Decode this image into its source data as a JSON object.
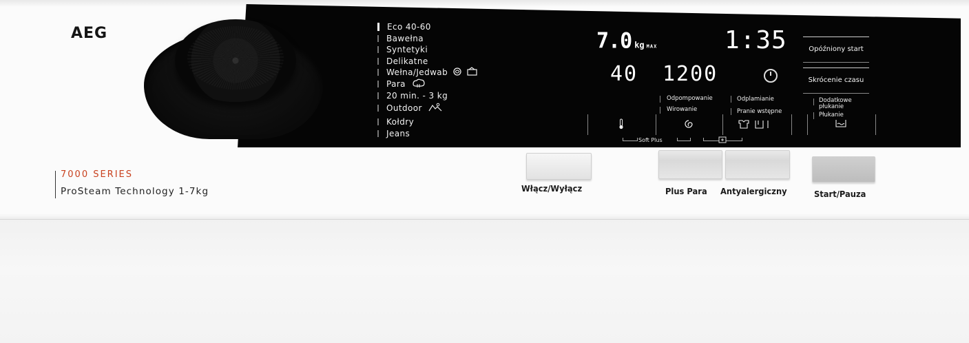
{
  "brand": {
    "logo": "AEG"
  },
  "series": {
    "name": "7000 SERIES",
    "technology": "ProSteam Technology 1-7kg",
    "accent_color": "#c8401d"
  },
  "programs": [
    {
      "label": "Eco 40-60",
      "active": true,
      "icon": ""
    },
    {
      "label": "Bawełna",
      "active": false,
      "icon": ""
    },
    {
      "label": "Syntetyki",
      "active": false,
      "icon": ""
    },
    {
      "label": "Delikatne",
      "active": false,
      "icon": ""
    },
    {
      "label": "Wełna/Jedwab",
      "active": false,
      "icon": "wool-handwash-icon"
    },
    {
      "label": "Para",
      "active": false,
      "icon": "steam-icon"
    },
    {
      "label": "20 min. - 3 kg",
      "active": false,
      "icon": ""
    },
    {
      "label": "Outdoor",
      "active": false,
      "icon": "outdoor-icon"
    },
    {
      "label": "Kołdry",
      "active": false,
      "icon": ""
    },
    {
      "label": "Jeans",
      "active": false,
      "icon": ""
    }
  ],
  "display": {
    "load": "7.0",
    "load_unit": "kg",
    "load_max": "MAX",
    "time": "1:35",
    "temperature": "40",
    "spin": "1200"
  },
  "side_buttons": {
    "delay": "Opóźniony start",
    "time_saver": "Skrócenie czasu"
  },
  "options": {
    "drain": "Odpompowanie",
    "spin": "Wirowanie",
    "stain": "Odplamianie",
    "prewash": "Pranie wstępne",
    "extra_rinse": "Dodatkowe płukanie",
    "rinse": "Płukanie",
    "soft_plus": "Soft Plus"
  },
  "buttons": {
    "power": "Włącz/Wyłącz",
    "plus_steam": "Plus Para",
    "anti_allergy": "Antyalergiczny",
    "start_pause": "Start/Pauza"
  }
}
